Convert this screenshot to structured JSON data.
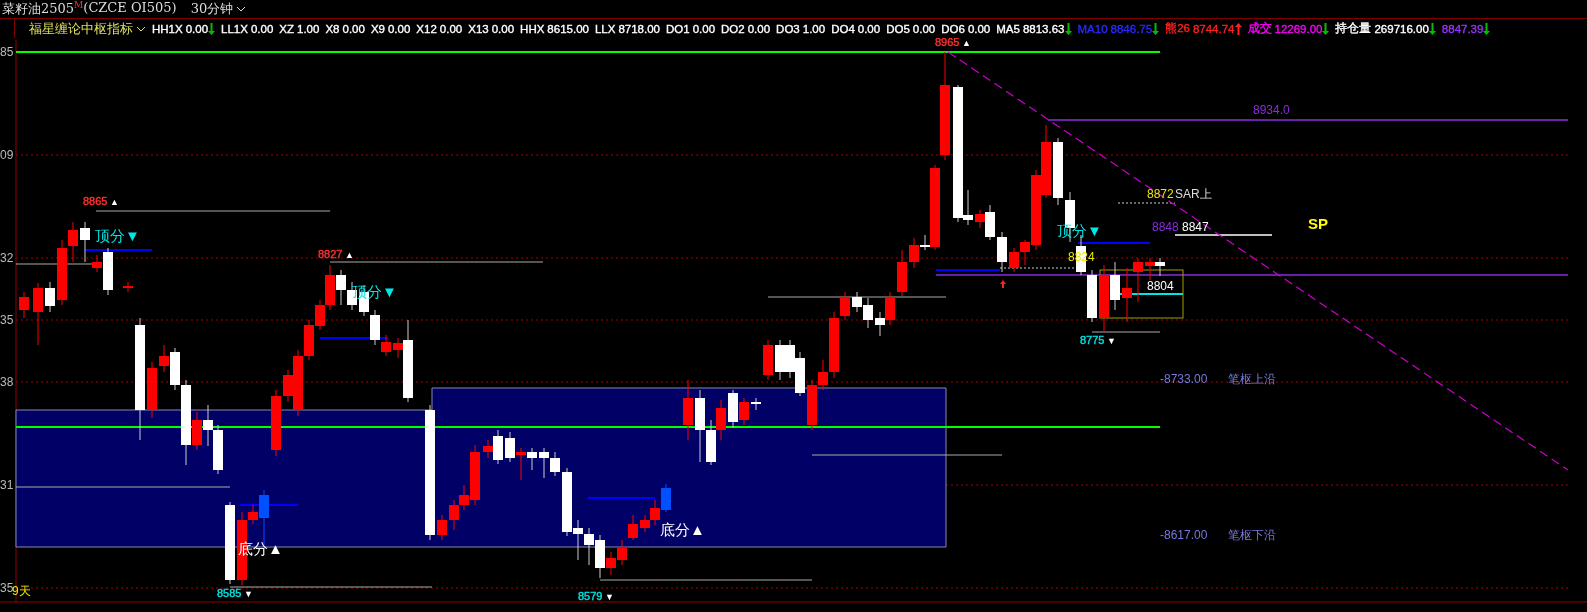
{
  "header": {
    "symbol": "菜籽油2505",
    "badge": "M",
    "code": "(CZCE OI505)",
    "period": "30分钟"
  },
  "indicator": {
    "name": "福星缠论中枢指标",
    "values": [
      {
        "label": "HH1X",
        "value": "0.00",
        "color": "#ffffff",
        "arrow": {
          "kind": "down",
          "color": "#00c000"
        }
      },
      {
        "label": "LL1X",
        "value": "0.00",
        "color": "#ffffff"
      },
      {
        "label": "XZ",
        "value": "1.00",
        "color": "#ffffff"
      },
      {
        "label": "X8",
        "value": "0.00",
        "color": "#ffffff"
      },
      {
        "label": "X9",
        "value": "0.00",
        "color": "#ffffff"
      },
      {
        "label": "X12",
        "value": "0.00",
        "color": "#ffffff"
      },
      {
        "label": "X13",
        "value": "0.00",
        "color": "#ffffff"
      },
      {
        "label": "HHX",
        "value": "8615.00",
        "color": "#ffffff"
      },
      {
        "label": "LLX",
        "value": "8718.00",
        "color": "#ffffff"
      },
      {
        "label": "DO1",
        "value": "0.00",
        "color": "#ffffff"
      },
      {
        "label": "DO2",
        "value": "0.00",
        "color": "#ffffff"
      },
      {
        "label": "DO3",
        "value": "1.00",
        "color": "#ffffff"
      },
      {
        "label": "DO4",
        "value": "0.00",
        "color": "#ffffff"
      },
      {
        "label": "DO5",
        "value": "0.00",
        "color": "#ffffff"
      },
      {
        "label": "DO6",
        "value": "0.00",
        "color": "#ffffff"
      },
      {
        "label": "MA5",
        "value": "8813.63",
        "color": "#ffffff",
        "arrow": {
          "kind": "down",
          "color": "#00c000"
        }
      },
      {
        "label": "MA10",
        "value": "8846.75",
        "color": "#2a2aff",
        "arrow": {
          "kind": "down",
          "color": "#00c000"
        }
      },
      {
        "label": "熊26",
        "value": "8744.74",
        "color": "#ff2020",
        "arrow": {
          "kind": "up",
          "color": "#ff2020"
        }
      },
      {
        "label": "成交",
        "value": "12269.00",
        "color": "#ff00ff",
        "arrow": {
          "kind": "down",
          "color": "#00c000"
        }
      },
      {
        "label": "持仓量",
        "value": "269716.00",
        "color": "#ffffff",
        "arrow": {
          "kind": "down",
          "color": "#00c000"
        }
      },
      {
        "value": "8847.39",
        "color": "#9933ff",
        "arrow": {
          "kind": "down",
          "color": "#00c000"
        }
      }
    ]
  },
  "axis_labels": [
    "85",
    "09",
    "32",
    "35",
    "38",
    "31",
    "35"
  ],
  "price_marks": [
    {
      "text": "8865",
      "marker": "▲",
      "color": "#ff3030"
    },
    {
      "text": "8827",
      "marker": "▲",
      "color": "#ff3030"
    },
    {
      "text": "8965",
      "marker": "▲",
      "color": "#ff3030"
    },
    {
      "text": "8585",
      "marker": "▼",
      "color": "#00e0e0"
    },
    {
      "text": "8579",
      "marker": "▼",
      "color": "#00e0e0"
    },
    {
      "text": "8775",
      "marker": "▼",
      "color": "#00e0e0"
    }
  ],
  "labels": [
    {
      "text": "顶分▼",
      "color": "#00e5e5"
    },
    {
      "text": "顶分▼",
      "color": "#00e5e5"
    },
    {
      "text": "顶分▼",
      "color": "#00e5e5"
    },
    {
      "text": "底分▲",
      "color": "#ffffff"
    },
    {
      "text": "底分▲",
      "color": "#ffffff"
    },
    {
      "text": "8872",
      "color": "#e8e800"
    },
    {
      "text": "SAR上",
      "color": "#dddddd"
    },
    {
      "text": "8848",
      "color": "#8a2be2"
    },
    {
      "text": "8847",
      "color": "#ffffff"
    },
    {
      "text": "8824",
      "color": "#e8e800"
    },
    {
      "text": "8804",
      "color": "#ffffff"
    },
    {
      "text": "SP",
      "color": "#ffff00"
    },
    {
      "text": "8934.0",
      "color": "#8a2be2"
    },
    {
      "text": "-8733.00",
      "color": "#7777dd"
    },
    {
      "text": "笔枢上沿",
      "color": "#7777dd"
    },
    {
      "text": "-8617.00",
      "color": "#7777dd"
    },
    {
      "text": "笔枢下沿",
      "color": "#7777dd"
    },
    {
      "text": "9天",
      "color": "#e8e800"
    }
  ]
}
